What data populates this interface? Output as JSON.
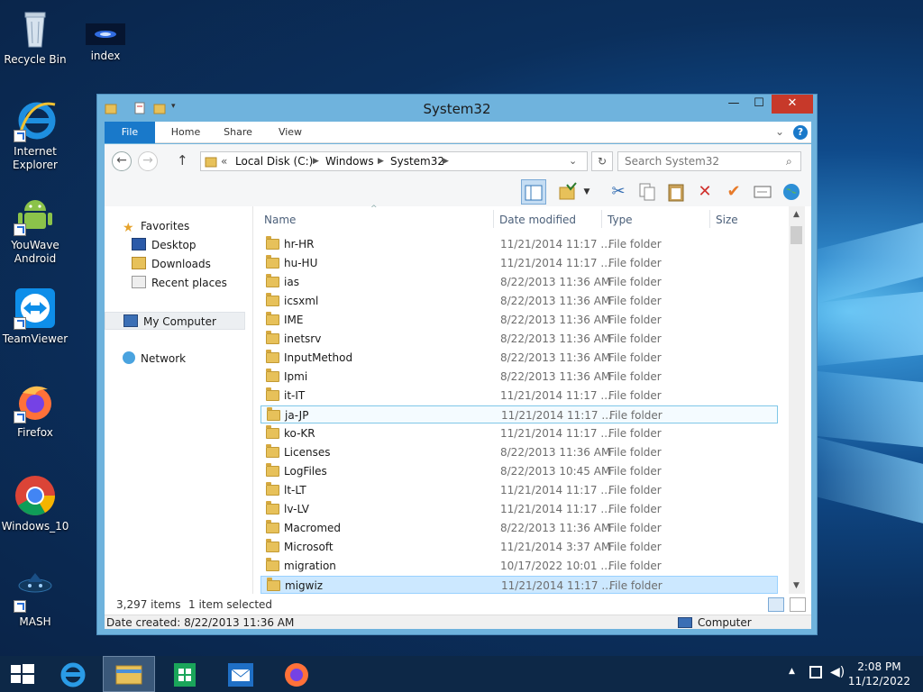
{
  "desktop": {
    "icons": [
      {
        "label": "Recycle Bin",
        "icon": "recycle-bin-icon"
      },
      {
        "label": "index",
        "icon": "video-file-icon"
      },
      {
        "label": "Internet Explorer",
        "icon": "internet-explorer-icon"
      },
      {
        "label": "YouWave Android",
        "icon": "android-icon"
      },
      {
        "label": "TeamViewer",
        "icon": "teamviewer-icon"
      },
      {
        "label": "Firefox",
        "icon": "firefox-icon"
      },
      {
        "label": "Windows_10",
        "icon": "chrome-icon"
      },
      {
        "label": "MASH",
        "icon": "mash-icon"
      }
    ]
  },
  "window": {
    "title": "System32",
    "minimize": "—",
    "maximize": "☐",
    "close": "✕",
    "ribbon_tabs": [
      "File",
      "Home",
      "Share",
      "View"
    ],
    "address": {
      "overflow": "«",
      "crumbs": [
        "Local Disk (C:)",
        "Windows",
        "System32"
      ]
    },
    "search_placeholder": "Search System32",
    "navigation": {
      "favorites": "Favorites",
      "favorites_items": [
        "Desktop",
        "Downloads",
        "Recent places"
      ],
      "computer": "My Computer",
      "network": "Network"
    },
    "columns": [
      "Name",
      "Date modified",
      "Type",
      "Size"
    ],
    "rows": [
      {
        "name": "hr-HR",
        "date": "11/21/2014 11:17 ...",
        "type": "File folder"
      },
      {
        "name": "hu-HU",
        "date": "11/21/2014 11:17 ...",
        "type": "File folder"
      },
      {
        "name": "ias",
        "date": "8/22/2013 11:36 AM",
        "type": "File folder"
      },
      {
        "name": "icsxml",
        "date": "8/22/2013 11:36 AM",
        "type": "File folder"
      },
      {
        "name": "IME",
        "date": "8/22/2013 11:36 AM",
        "type": "File folder"
      },
      {
        "name": "inetsrv",
        "date": "8/22/2013 11:36 AM",
        "type": "File folder"
      },
      {
        "name": "InputMethod",
        "date": "8/22/2013 11:36 AM",
        "type": "File folder"
      },
      {
        "name": "Ipmi",
        "date": "8/22/2013 11:36 AM",
        "type": "File folder"
      },
      {
        "name": "it-IT",
        "date": "11/21/2014 11:17 ...",
        "type": "File folder"
      },
      {
        "name": "ja-JP",
        "date": "11/21/2014 11:17 ...",
        "type": "File folder"
      },
      {
        "name": "ko-KR",
        "date": "11/21/2014 11:17 ...",
        "type": "File folder"
      },
      {
        "name": "Licenses",
        "date": "8/22/2013 11:36 AM",
        "type": "File folder"
      },
      {
        "name": "LogFiles",
        "date": "8/22/2013 10:45 AM",
        "type": "File folder"
      },
      {
        "name": "lt-LT",
        "date": "11/21/2014 11:17 ...",
        "type": "File folder"
      },
      {
        "name": "lv-LV",
        "date": "11/21/2014 11:17 ...",
        "type": "File folder"
      },
      {
        "name": "Macromed",
        "date": "8/22/2013 11:36 AM",
        "type": "File folder"
      },
      {
        "name": "Microsoft",
        "date": "11/21/2014 3:37 AM",
        "type": "File folder"
      },
      {
        "name": "migration",
        "date": "10/17/2022 10:01 ...",
        "type": "File folder"
      },
      {
        "name": "migwiz",
        "date": "11/21/2014 11:17 ...",
        "type": "File folder"
      }
    ],
    "focused_row": "ja-JP",
    "selected_row": "migwiz",
    "status": {
      "count": "3,297 items",
      "selected": "1 item selected"
    },
    "details": {
      "date_created": "Date created: 8/22/2013 11:36 AM",
      "location": "Computer"
    }
  },
  "taskbar": {
    "items": [
      "start-icon",
      "internet-explorer-icon",
      "file-explorer-icon",
      "store-icon",
      "mail-icon",
      "firefox-icon"
    ],
    "active": "file-explorer-icon",
    "time": "2:08 PM",
    "date": "11/12/2022"
  },
  "colors": {
    "accent": "#1979ca",
    "close": "#c7392a",
    "selection": "#cce8ff",
    "taskbar": "#0d2847"
  }
}
